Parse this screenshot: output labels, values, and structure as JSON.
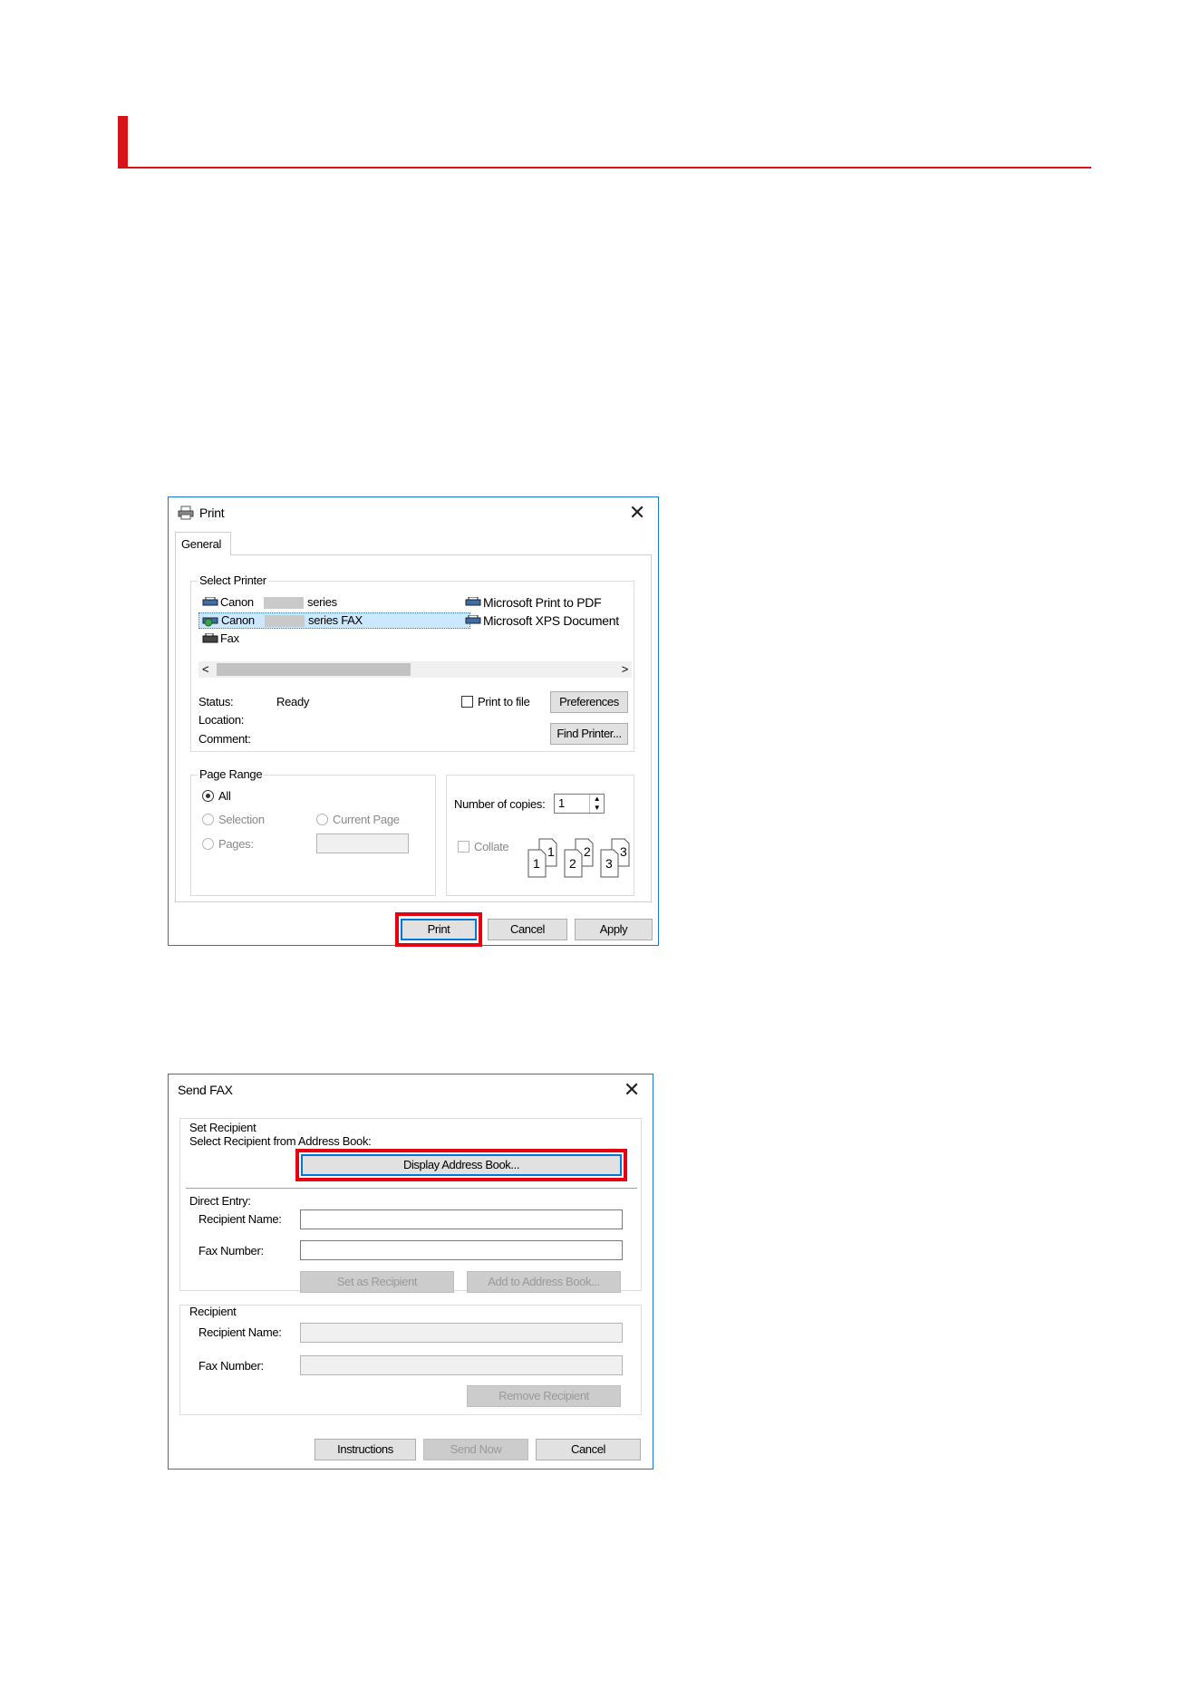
{
  "print_dialog": {
    "title": "Print",
    "tab_general": "General",
    "select_printer_label": "Select Printer",
    "printers_left": [
      {
        "name": "Canon",
        "suffix": "series"
      },
      {
        "name": "Canon",
        "suffix": "series FAX"
      },
      {
        "name": "Fax",
        "suffix": ""
      }
    ],
    "printers_right": [
      "Microsoft Print to PDF",
      "Microsoft XPS Document"
    ],
    "status_label": "Status:",
    "status_value": "Ready",
    "location_label": "Location:",
    "comment_label": "Comment:",
    "print_to_file_label": "Print to file",
    "preferences_button": "Preferences",
    "find_printer_button": "Find Printer...",
    "page_range_label": "Page Range",
    "all_label": "All",
    "selection_label": "Selection",
    "current_page_label": "Current Page",
    "pages_label": "Pages:",
    "copies_label": "Number of copies:",
    "copies_value": "1",
    "collate_label": "Collate",
    "collate_pages": [
      "1",
      "1",
      "2",
      "2",
      "3",
      "3"
    ],
    "print_button": "Print",
    "cancel_button": "Cancel",
    "apply_button": "Apply"
  },
  "fax_dialog": {
    "title": "Send FAX",
    "set_recipient_label": "Set Recipient",
    "select_from_book_label": "Select Recipient from Address Book:",
    "display_address_book_button": "Display Address Book...",
    "direct_entry_label": "Direct Entry:",
    "recipient_name_label": "Recipient Name:",
    "fax_number_label": "Fax Number:",
    "set_as_recipient_button": "Set as Recipient",
    "add_to_address_book_button": "Add to Address Book...",
    "recipient_group_label": "Recipient",
    "recipient_name_label_2": "Recipient Name:",
    "fax_number_label_2": "Fax Number:",
    "remove_recipient_button": "Remove Recipient",
    "instructions_button": "Instructions",
    "send_now_button": "Send Now",
    "cancel_button": "Cancel"
  },
  "colors": {
    "accent_red": "#d7141a",
    "highlight_red": "#e60012",
    "dialog_border_blue": "#1c78d3",
    "selection_blue": "#cce8ff"
  }
}
